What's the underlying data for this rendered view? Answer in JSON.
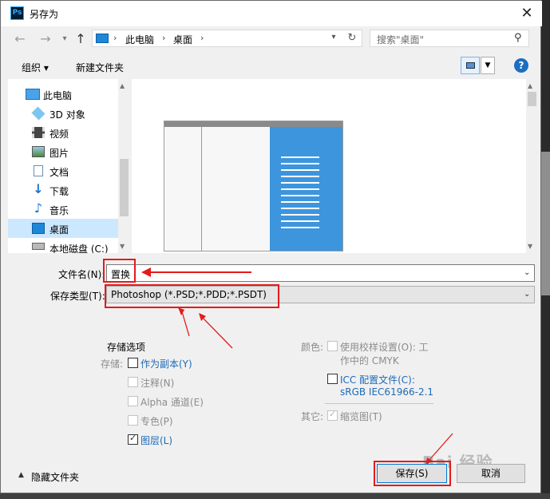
{
  "title": "另存为",
  "nav": {
    "back": "←",
    "forward": "→",
    "up": "↑"
  },
  "address": {
    "root_sep": "›",
    "part1": "此电脑",
    "sep": "›",
    "part2": "桌面",
    "sep2": "›"
  },
  "search": {
    "placeholder": "搜索\"桌面\""
  },
  "toolbar": {
    "organize": "组织 ▾",
    "new_folder": "新建文件夹"
  },
  "sidebar": {
    "items": [
      {
        "label": "此电脑",
        "icon": "computer-icon"
      },
      {
        "label": "3D 对象",
        "icon": "cube-icon"
      },
      {
        "label": "视频",
        "icon": "video-icon"
      },
      {
        "label": "图片",
        "icon": "picture-icon"
      },
      {
        "label": "文档",
        "icon": "document-icon"
      },
      {
        "label": "下载",
        "icon": "download-icon"
      },
      {
        "label": "音乐",
        "icon": "music-icon"
      },
      {
        "label": "桌面",
        "icon": "desktop-icon"
      },
      {
        "label": "本地磁盘 (C:)",
        "icon": "disk-icon"
      }
    ]
  },
  "filename": {
    "label": "文件名(N):",
    "value": "置换"
  },
  "filetype": {
    "label": "保存类型(T):",
    "value": "Photoshop (*.PSD;*.PDD;*.PSDT)"
  },
  "options": {
    "header": "存储选项",
    "storage_label": "存储:",
    "as_copy": "作为副本(Y)",
    "notes": "注释(N)",
    "alpha": "Alpha 通道(E)",
    "spot": "专色(P)",
    "layers": "图层(L)"
  },
  "color": {
    "label": "颜色:",
    "proof_line1": "使用校样设置(O):  工",
    "proof_line2": "作中的 CMYK",
    "icc_line1": "ICC 配置文件(C):",
    "icc_line2": "sRGB IEC61966-2.1"
  },
  "other": {
    "label": "其它:",
    "thumbnail": "缩览图(T)"
  },
  "footer": {
    "hide_folders": "隐藏文件夹",
    "save": "保存(S)",
    "cancel": "取消"
  },
  "watermark": "Bai 经验",
  "colors": {
    "accent": "#1d6ab8",
    "annotation": "#e41b1b",
    "selected": "#cce8ff",
    "preview_blue": "#3d95de"
  }
}
